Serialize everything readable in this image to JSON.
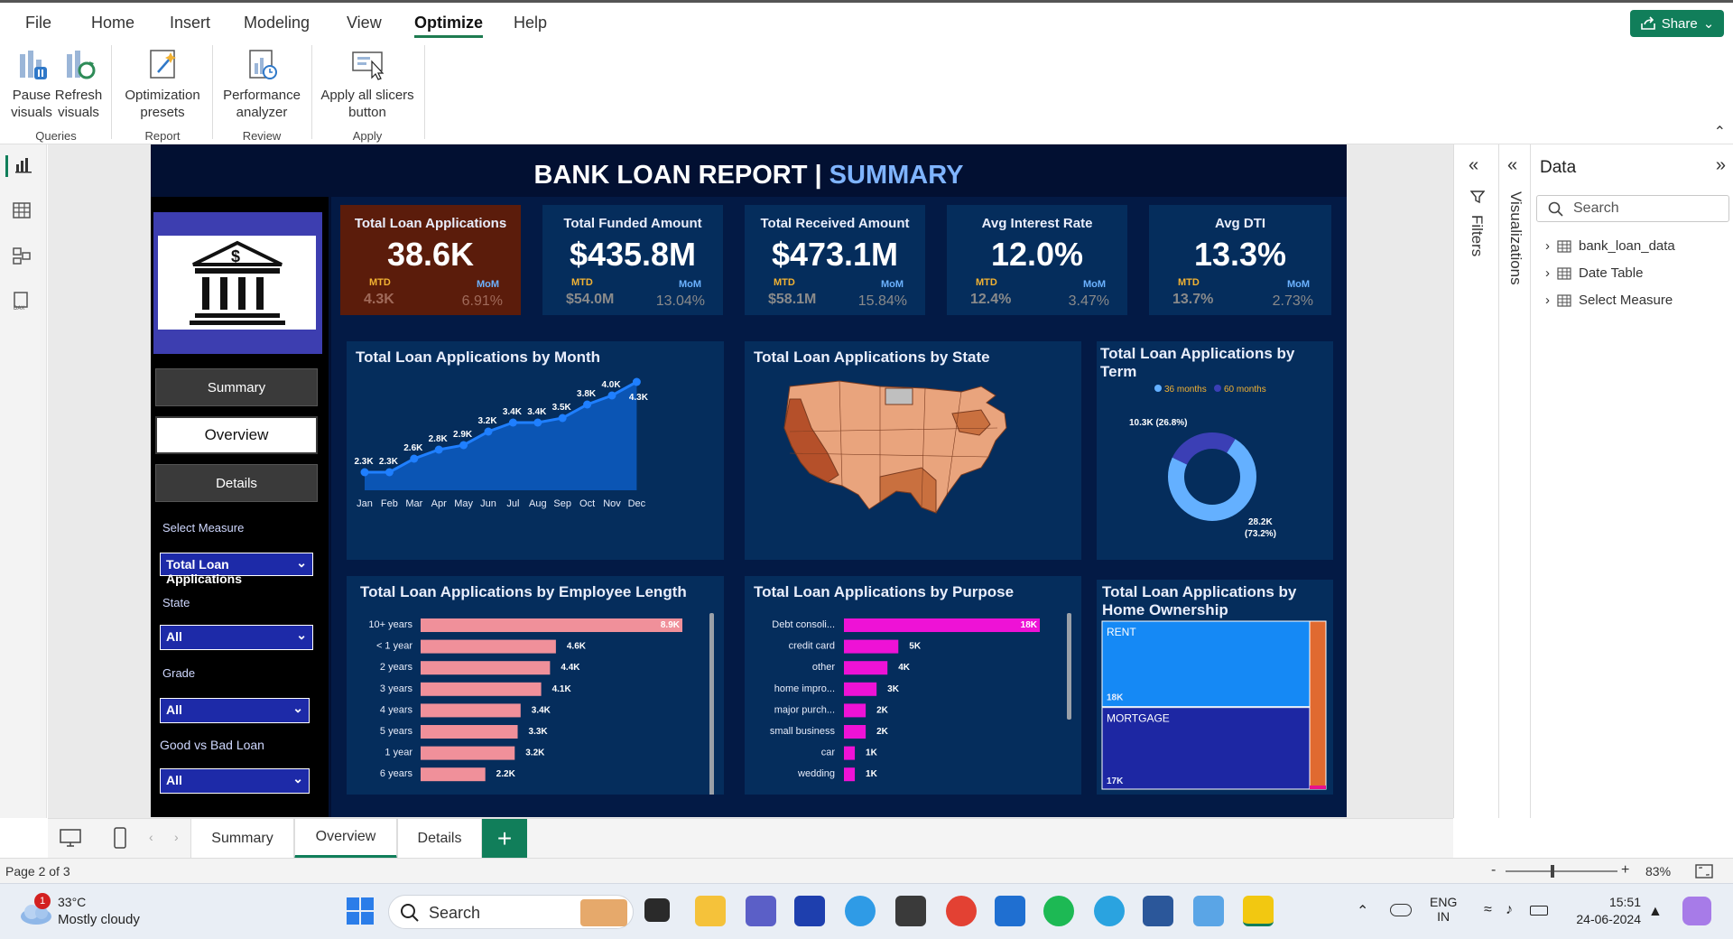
{
  "menu": {
    "items": [
      "File",
      "Home",
      "Insert",
      "Modeling",
      "View",
      "Optimize",
      "Help"
    ],
    "active": "Optimize",
    "share_label": "Share"
  },
  "ribbon": {
    "buttons": {
      "pause": "Pause\nvisuals",
      "refresh": "Refresh\nvisuals",
      "presets": "Optimization\npresets",
      "perf": "Performance\nanalyzer",
      "apply": "Apply all slicers\nbutton"
    },
    "groups": [
      "Queries",
      "Report",
      "Review",
      "Apply"
    ]
  },
  "report": {
    "title_main": "BANK LOAN REPORT | ",
    "title_accent": "SUMMARY",
    "nav": [
      "Summary",
      "Overview",
      "Details"
    ],
    "filters": {
      "measure_label": "Select Measure",
      "measure_value": "Total Loan Applications",
      "state_label": "State",
      "state_value": "All",
      "grade_label": "Grade",
      "grade_value": "All",
      "goodbad_label": "Good vs Bad Loan",
      "goodbad_value": "All"
    },
    "kpis": [
      {
        "title": "Total Loan Applications",
        "value": "38.6K",
        "mtd_label": "MTD",
        "mom_label": "MoM",
        "mtd": "4.3K",
        "mom": "6.91%"
      },
      {
        "title": "Total Funded Amount",
        "value": "$435.8M",
        "mtd_label": "MTD",
        "mom_label": "MoM",
        "mtd": "$54.0M",
        "mom": "13.04%"
      },
      {
        "title": "Total Received Amount",
        "value": "$473.1M",
        "mtd_label": "MTD",
        "mom_label": "MoM",
        "mtd": "$58.1M",
        "mom": "15.84%"
      },
      {
        "title": "Avg Interest Rate",
        "value": "12.0%",
        "mtd_label": "MTD",
        "mom_label": "MoM",
        "mtd": "12.4%",
        "mom": "3.47%"
      },
      {
        "title": "Avg DTI",
        "value": "13.3%",
        "mtd_label": "MTD",
        "mom_label": "MoM",
        "mtd": "13.7%",
        "mom": "2.73%"
      }
    ],
    "panels": {
      "month_title": "Total Loan Applications by Month",
      "state_title": "Total Loan Applications by State",
      "term_title": "Total Loan Applications by Term",
      "emp_title": "Total Loan Applications by Employee Length",
      "purpose_title": "Total Loan Applications by Purpose",
      "home_title": "Total Loan Applications by Home Ownership"
    }
  },
  "chart_data": [
    {
      "type": "area",
      "title": "Total Loan Applications by Month",
      "categories": [
        "Jan",
        "Feb",
        "Mar",
        "Apr",
        "May",
        "Jun",
        "Jul",
        "Aug",
        "Sep",
        "Oct",
        "Nov",
        "Dec"
      ],
      "values": [
        2.3,
        2.3,
        2.6,
        2.8,
        2.9,
        3.2,
        3.4,
        3.4,
        3.5,
        3.8,
        4.0,
        4.3
      ],
      "labels": [
        "2.3K",
        "2.3K",
        "2.6K",
        "2.8K",
        "2.9K",
        "3.2K",
        "3.4K",
        "3.4K",
        "3.5K",
        "3.8K",
        "4.0K",
        "4.3K"
      ],
      "color": "#1f6fe0"
    },
    {
      "type": "pie",
      "title": "Total Loan Applications by Term",
      "legend": [
        "36 months",
        "60 months"
      ],
      "values": [
        28.2,
        10.3
      ],
      "labels": [
        "28.2K\n(73.2%)",
        "10.3K (26.8%)"
      ],
      "colors": [
        "#64b0ff",
        "#3b3fb5"
      ]
    },
    {
      "type": "bar",
      "title": "Total Loan Applications by Employee Length",
      "categories": [
        "10+ years",
        "< 1 year",
        "2 years",
        "3 years",
        "4 years",
        "5 years",
        "1 year",
        "6 years"
      ],
      "values": [
        8.9,
        4.6,
        4.4,
        4.1,
        3.4,
        3.3,
        3.2,
        2.2
      ],
      "labels": [
        "8.9K",
        "4.6K",
        "4.4K",
        "4.1K",
        "3.4K",
        "3.3K",
        "3.2K",
        "2.2K"
      ],
      "color": "#f0909a"
    },
    {
      "type": "bar",
      "title": "Total Loan Applications by Purpose",
      "categories": [
        "Debt consoli...",
        "credit card",
        "other",
        "home impro...",
        "major purch...",
        "small business",
        "car",
        "wedding"
      ],
      "values": [
        18,
        5,
        4,
        3,
        2,
        2,
        1,
        1
      ],
      "labels": [
        "18K",
        "5K",
        "4K",
        "3K",
        "2K",
        "2K",
        "1K",
        "1K"
      ],
      "color": "#ee12d6"
    },
    {
      "type": "heatmap",
      "title": "Total Loan Applications by Home Ownership",
      "categories": [
        "RENT",
        "MORTGAGE"
      ],
      "values": [
        18,
        17
      ],
      "labels": [
        "18K",
        "17K"
      ],
      "colors": [
        "#1589f5",
        "#1d27a3",
        "#e06a30"
      ]
    }
  ],
  "panes": {
    "filters_label": "Filters",
    "viz_label": "Visualizations",
    "data_title": "Data",
    "search_placeholder": "Search",
    "data_items": [
      "bank_loan_data",
      "Date Table",
      "Select Measure"
    ]
  },
  "pages": {
    "tabs": [
      "Summary",
      "Overview",
      "Details"
    ],
    "active": "Overview",
    "add": "+"
  },
  "status": {
    "page": "Page 2 of 3",
    "zoom": "83%"
  },
  "taskbar": {
    "weather_temp": "33°C",
    "weather_desc": "Mostly cloudy",
    "weather_badge": "1",
    "search": "Search",
    "lang1": "ENG",
    "lang2": "IN",
    "time": "15:51",
    "date": "24-06-2024"
  }
}
